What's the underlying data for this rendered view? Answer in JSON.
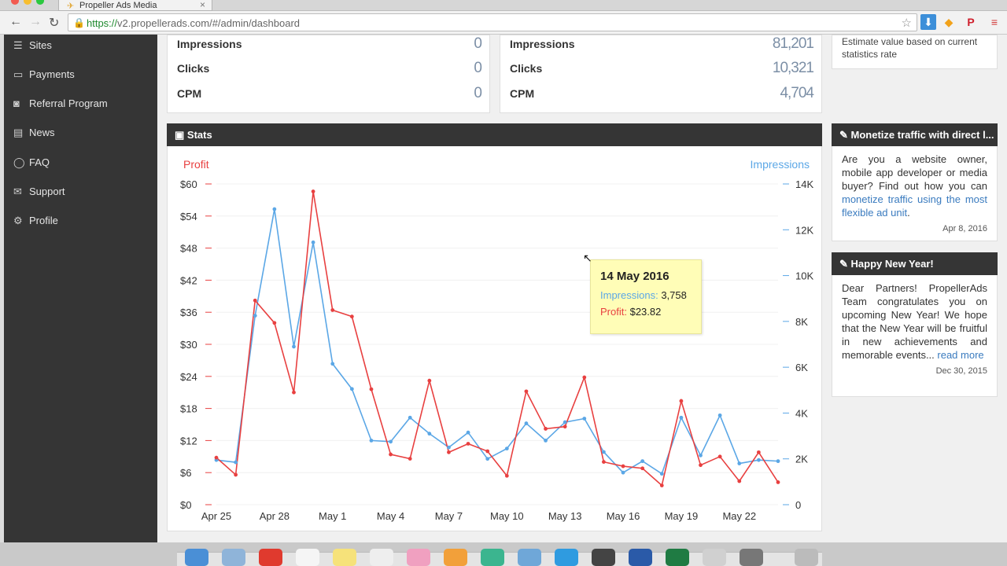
{
  "browser": {
    "tab_title": "Propeller Ads Media",
    "url_scheme": "https://",
    "url_rest": "v2.propellerads.com/#/admin/dashboard"
  },
  "sidebar": {
    "items": [
      {
        "label": "Sites",
        "icon": "list-icon"
      },
      {
        "label": "Payments",
        "icon": "credit-card-icon"
      },
      {
        "label": "Referral Program",
        "icon": "money-icon"
      },
      {
        "label": "News",
        "icon": "newspaper-icon"
      },
      {
        "label": "FAQ",
        "icon": "comment-icon"
      },
      {
        "label": "Support",
        "icon": "envelope-icon"
      },
      {
        "label": "Profile",
        "icon": "gears-icon"
      }
    ]
  },
  "summary_left": {
    "impressions_label": "Impressions",
    "impressions_value": "0",
    "clicks_label": "Clicks",
    "clicks_value": "0",
    "cpm_label": "CPM",
    "cpm_value": "0"
  },
  "summary_right": {
    "impressions_label": "Impressions",
    "impressions_value": "81,201",
    "clicks_label": "Clicks",
    "clicks_value": "10,321",
    "cpm_label": "CPM",
    "cpm_value": "4,704"
  },
  "estimate_note": "Estimate value based on current statistics rate",
  "stats": {
    "title": "Stats"
  },
  "tooltip": {
    "date": "14 May 2016",
    "impressions_label": "Impressions:",
    "impressions_value": "3,758",
    "profit_label": "Profit:",
    "profit_value": "$23.82"
  },
  "news": [
    {
      "title": "Monetize traffic with direct l...",
      "text": "Are you a website owner, mobile app developer or media buyer? Find out how you can ",
      "link": "monetize traffic using the most flexible ad unit",
      "after": ".",
      "date": "Apr 8, 2016"
    },
    {
      "title": "Happy New Year!",
      "text": "Dear Partners! PropellerAds Team congratulates you on upcoming New Year! We hope that the New Year will be fruitful in new achievements and memorable events... ",
      "link": "read more",
      "after": "",
      "date": "Dec 30, 2015"
    }
  ],
  "colors": {
    "profit": "#e84040",
    "impressions": "#5ba7e6",
    "dark_header": "#353535",
    "tooltip_bg": "#fffdb7"
  },
  "chart_data": {
    "type": "line",
    "left_axis_title": "Profit",
    "right_axis_title": "Impressions",
    "left_ylim": [
      0,
      60
    ],
    "right_ylim": [
      0,
      14000
    ],
    "left_ticks": [
      "$60",
      "$54",
      "$48",
      "$42",
      "$36",
      "$30",
      "$24",
      "$18",
      "$12",
      "$6",
      "$0"
    ],
    "right_ticks": [
      "14K",
      "12K",
      "10K",
      "8K",
      "6K",
      "4K",
      "2K",
      "0"
    ],
    "x_tick_labels": [
      {
        "label": "Apr 25",
        "index": 0
      },
      {
        "label": "Apr 28",
        "index": 3
      },
      {
        "label": "May 1",
        "index": 6
      },
      {
        "label": "May 4",
        "index": 9
      },
      {
        "label": "May 7",
        "index": 12
      },
      {
        "label": "May 10",
        "index": 15
      },
      {
        "label": "May 13",
        "index": 18
      },
      {
        "label": "May 16",
        "index": 21
      },
      {
        "label": "May 19",
        "index": 24
      },
      {
        "label": "May 22",
        "index": 27
      }
    ],
    "dates": [
      "Apr 25",
      "Apr 26",
      "Apr 27",
      "Apr 28",
      "Apr 29",
      "Apr 30",
      "May 1",
      "May 2",
      "May 3",
      "May 4",
      "May 5",
      "May 6",
      "May 7",
      "May 8",
      "May 9",
      "May 10",
      "May 11",
      "May 12",
      "May 13",
      "May 14",
      "May 15",
      "May 16",
      "May 17",
      "May 18",
      "May 19",
      "May 20",
      "May 21",
      "May 22",
      "May 23",
      "May 24",
      "May 25"
    ],
    "series": [
      {
        "name": "Profit",
        "axis": "left",
        "values": [
          8.8,
          5.6,
          38.2,
          34.0,
          21.0,
          58.6,
          36.4,
          35.2,
          21.6,
          9.4,
          8.6,
          23.2,
          9.8,
          11.4,
          10.0,
          5.4,
          21.2,
          14.2,
          14.6,
          23.82,
          8.0,
          7.2,
          6.8,
          3.6,
          19.4,
          7.4,
          9.0,
          4.4,
          9.8,
          4.2
        ]
      },
      {
        "name": "Impressions",
        "axis": "right",
        "values": [
          1950,
          1850,
          8250,
          12900,
          6900,
          11450,
          6150,
          5050,
          2800,
          2750,
          3800,
          3100,
          2500,
          3150,
          2000,
          2450,
          3550,
          2800,
          3600,
          3758,
          2300,
          1400,
          1900,
          1350,
          3800,
          2150,
          3900,
          1800,
          1950,
          1900
        ]
      }
    ]
  }
}
